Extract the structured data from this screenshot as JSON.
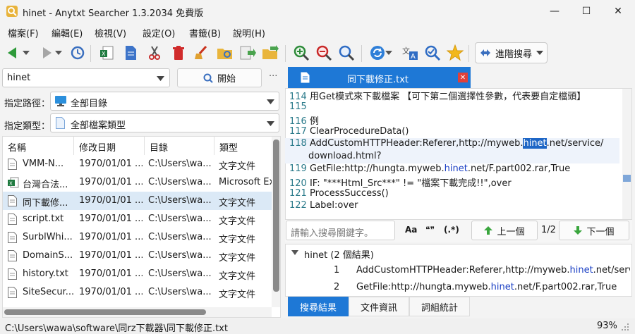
{
  "window": {
    "title": "hinet - Anytxt Searcher 1.3.2034 免費版",
    "minimize": "—",
    "maximize": "☐",
    "close": "✕"
  },
  "menu": [
    "檔案(F)",
    "編輯(E)",
    "檢視(V)",
    "設定(O)",
    "書籤(B)",
    "說明(H)"
  ],
  "toolbar": {
    "advanced_search_label": "進階搜尋"
  },
  "search": {
    "query": "hinet",
    "start_label": "開始",
    "more": "···"
  },
  "filters": {
    "path_label": "指定路徑：",
    "path_value": "全部目錄",
    "type_label": "指定類型：",
    "type_value": "全部檔案類型"
  },
  "file_table": {
    "headers": [
      "名稱",
      "修改日期",
      "目錄",
      "類型"
    ],
    "rows": [
      {
        "name": "VMM-N...",
        "date": "1970/01/01 ...",
        "dir": "C:\\Users\\wa...",
        "type": "文字文件",
        "icon": "text-file-icon"
      },
      {
        "name": "台灣合法...",
        "date": "1970/01/01 ...",
        "dir": "C:\\Users\\wa...",
        "type": "Microsoft Ex",
        "icon": "excel-file-icon"
      },
      {
        "name": "同下載修...",
        "date": "1970/01/01 ...",
        "dir": "C:\\Users\\wa...",
        "type": "文字文件",
        "icon": "text-file-icon"
      },
      {
        "name": "script.txt",
        "date": "1970/01/01 ...",
        "dir": "C:\\Users\\wa...",
        "type": "文字文件",
        "icon": "text-file-icon"
      },
      {
        "name": "SurblWhi...",
        "date": "1970/01/01 ...",
        "dir": "C:\\Users\\wa...",
        "type": "文字文件",
        "icon": "text-file-icon"
      },
      {
        "name": "DomainS...",
        "date": "1970/01/01 ...",
        "dir": "C:\\Users\\wa...",
        "type": "文字文件",
        "icon": "text-file-icon"
      },
      {
        "name": "history.txt",
        "date": "1970/01/01 ...",
        "dir": "C:\\Users\\wa...",
        "type": "文字文件",
        "icon": "text-file-icon"
      },
      {
        "name": "SiteSecur...",
        "date": "1970/01/01 ...",
        "dir": "C:\\Users\\wa...",
        "type": "文字文件",
        "icon": "text-file-icon"
      }
    ]
  },
  "preview": {
    "tab_label": "同下載修正.txt",
    "lines": [
      {
        "n": "114",
        "pre": "用Get模式來下載檔案 【可下第二個選擇性參數，代表要自定檔頭】",
        "hit": "",
        "post": ""
      },
      {
        "n": "115",
        "pre": "",
        "hit": "",
        "post": ""
      },
      {
        "n": "116",
        "pre": "例",
        "hit": "",
        "post": ""
      },
      {
        "n": "117",
        "pre": "ClearProcedureData()",
        "hit": "",
        "post": ""
      },
      {
        "n": "118",
        "pre": "AddCustomHTTPHeader:Referer,http://myweb.",
        "hit": "hinet",
        "post": ".net/service/"
      },
      {
        "n": "",
        "pre": "download.html?",
        "hit": "",
        "post": ""
      },
      {
        "n": "119",
        "pre": "GetFile:http://hungta.myweb.",
        "hit": "hinet",
        "post": ".net/F.part002.rar,True"
      },
      {
        "n": "120",
        "pre": "IF: \"***Html_Src***\" != \"檔案下載完成!!\",over",
        "hit": "",
        "post": ""
      },
      {
        "n": "121",
        "pre": "ProcessSuccess()",
        "hit": "",
        "post": ""
      },
      {
        "n": "122",
        "pre": "Label:over",
        "hit": "",
        "post": ""
      }
    ]
  },
  "find": {
    "placeholder": "請輸入搜尋關鍵字。",
    "case": "Aa",
    "word": "❝❞",
    "regex": "(.*)",
    "prev_label": "上一個",
    "count": "1/2",
    "next_label": "下一個"
  },
  "results": {
    "group": "hinet (2 個結果)",
    "items": [
      {
        "n": "1",
        "pre": "AddCustomHTTPHeader:Referer,http://myweb.",
        "hit": "hinet",
        "post": ".net/servic..."
      },
      {
        "n": "2",
        "pre": "GetFile:http://hungta.myweb.",
        "hit": "hinet",
        "post": ".net/F.part002.rar,True"
      }
    ]
  },
  "bottom_tabs": [
    "搜尋結果",
    "文件資訊",
    "詞組統計"
  ],
  "status": {
    "path": "C:\\Users\\wawa\\software\\同rz下載器\\同下載修正.txt",
    "zoom": "93%"
  },
  "colors": {
    "accent": "#1e78d6",
    "highlight": "#1e66c6",
    "keyword": "#1a3fc4"
  }
}
